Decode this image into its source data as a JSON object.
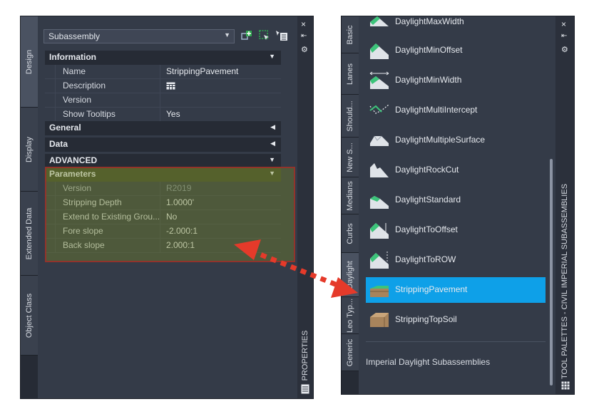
{
  "properties": {
    "tabs": [
      "Design",
      "Display",
      "Extended Data",
      "Object Class"
    ],
    "combo_value": "Subassembly",
    "title": "PROPERTIES",
    "sections": {
      "information": "Information",
      "general": "General",
      "data": "Data",
      "advanced": "ADVANCED",
      "parameters": "Parameters"
    },
    "information_rows": [
      {
        "key": "Name",
        "value": "StrippingPavement"
      },
      {
        "key": "Description",
        "value": ""
      },
      {
        "key": "Version",
        "value": ""
      },
      {
        "key": "Show Tooltips",
        "value": "Yes"
      }
    ],
    "parameter_rows": [
      {
        "key": "Version",
        "value": "R2019"
      },
      {
        "key": "Stripping Depth",
        "value": "1.0000'"
      },
      {
        "key": "Extend to Existing Grou...",
        "value": "No"
      },
      {
        "key": "Fore slope",
        "value": "-2.000:1"
      },
      {
        "key": "Back slope",
        "value": "2.000:1"
      }
    ]
  },
  "tool_palette": {
    "title": "TOOL PALETTES - CIVIL IMPERIAL SUBASSEMBLIES",
    "tabs": [
      "Basic",
      "Lanes",
      "Should...",
      "New S...",
      "Medians",
      "Curbs",
      "Daylight",
      "Leo Typ...",
      "Generic"
    ],
    "items": [
      {
        "label": "DaylightMaxWidth"
      },
      {
        "label": "DaylightMinOffset"
      },
      {
        "label": "DaylightMinWidth"
      },
      {
        "label": "DaylightMultiIntercept"
      },
      {
        "label": "DaylightMultipleSurface"
      },
      {
        "label": "DaylightRockCut"
      },
      {
        "label": "DaylightStandard"
      },
      {
        "label": "DaylightToOffset"
      },
      {
        "label": "DaylightToROW"
      },
      {
        "label": "StrippingPavement",
        "selected": true
      },
      {
        "label": "StrippingTopSoil"
      }
    ],
    "footer": "Imperial Daylight Subassemblies"
  },
  "colors": {
    "selected": "#0ea0e8",
    "highlight_fill": "#788c28",
    "highlight_border": "#aa2828",
    "arrow": "#e53a2a"
  },
  "icons": {
    "close": "×",
    "autohide": "⇤",
    "settings": "⚙"
  }
}
